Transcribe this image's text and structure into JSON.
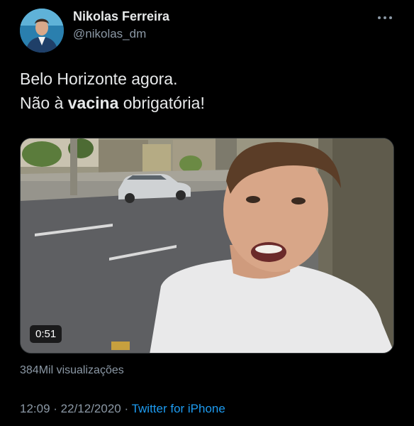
{
  "author": {
    "name": "Nikolas Ferreira",
    "handle": "@nikolas_dm"
  },
  "tweet": {
    "line1": "Belo Horizonte agora.",
    "line2_prefix": "Não à ",
    "line2_bold": "vacina",
    "line2_suffix": " obrigatória!"
  },
  "media": {
    "type": "video",
    "duration": "0:51"
  },
  "views": "384Mil visualizações",
  "meta": {
    "time": "12:09",
    "separator1": " · ",
    "date": "22/12/2020",
    "separator2": " · ",
    "source": "Twitter for iPhone"
  },
  "icons": {
    "more": "more-horizontal-icon",
    "avatar": "avatar"
  },
  "colors": {
    "background": "#000000",
    "text": "#e7e9ea",
    "secondary": "#8b98a5",
    "link": "#1d9bf0"
  }
}
